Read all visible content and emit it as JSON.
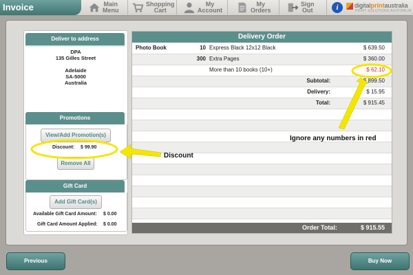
{
  "window": {
    "title": "Invoice"
  },
  "nav": [
    {
      "id": "main-menu",
      "line1": "Main",
      "line2": "Menu"
    },
    {
      "id": "shopping-cart",
      "line1": "Shopping",
      "line2": "Cart"
    },
    {
      "id": "my-account",
      "line1": "My",
      "line2": "Account"
    },
    {
      "id": "my-orders",
      "line1": "My",
      "line2": "Orders"
    },
    {
      "id": "sign-out",
      "line1": "Sign",
      "line2": "Out"
    }
  ],
  "brand": {
    "name_part1": "digital",
    "name_part2": "print",
    "name_part3": "australia",
    "tagline": "PRINT SOLUTIONS AUSTRALIA"
  },
  "address": {
    "header": "Deliver to address",
    "lines": [
      "DPA",
      "135 Gilles Street",
      "",
      "Adelaide",
      "SA-5000",
      "Australia"
    ]
  },
  "promotions": {
    "header": "Promotions",
    "view_button": "View/Add Promotion(s)",
    "discount_label": "Discount:",
    "discount_value": "$ 99.90",
    "remove_all_button": "Remove All"
  },
  "gift_card": {
    "header": "Gift Card",
    "add_button": "Add Gift Card(s)",
    "available_label": "Available Gift Card Amount:",
    "available_value": "$ 0.00",
    "applied_label": "Gift Card Amount Applied:",
    "applied_value": "$ 0.00"
  },
  "order": {
    "header": "Delivery Order",
    "lines": [
      {
        "item": "Photo Book",
        "qty": "10",
        "desc": "Express Black 12x12 Black",
        "amount": "$ 639.50"
      },
      {
        "item": "",
        "qty": "300",
        "desc": "Extra Pages",
        "amount": "$ 360.00"
      },
      {
        "item": "",
        "qty": "",
        "desc": "More than 10 books (10+)",
        "amount": "$ 62.10"
      }
    ],
    "subtotal_label": "Subtotal:",
    "subtotal_value": "$ 899.50",
    "delivery_label": "Delivery:",
    "delivery_value": "$ 15.95",
    "total_label": "Total:",
    "total_value": "$ 915.45",
    "order_total_label": "Order Total:",
    "order_total_value": "$ 915.55"
  },
  "footer": {
    "previous_button": "Previous",
    "buy_now_button": "Buy Now"
  },
  "annotations": {
    "discount_note": "Discount",
    "red_note": "Ignore any numbers in red"
  },
  "colors": {
    "teal": "#5b8f8c",
    "red_value": "#e0262a",
    "highlight_yellow": "#f5e600"
  }
}
